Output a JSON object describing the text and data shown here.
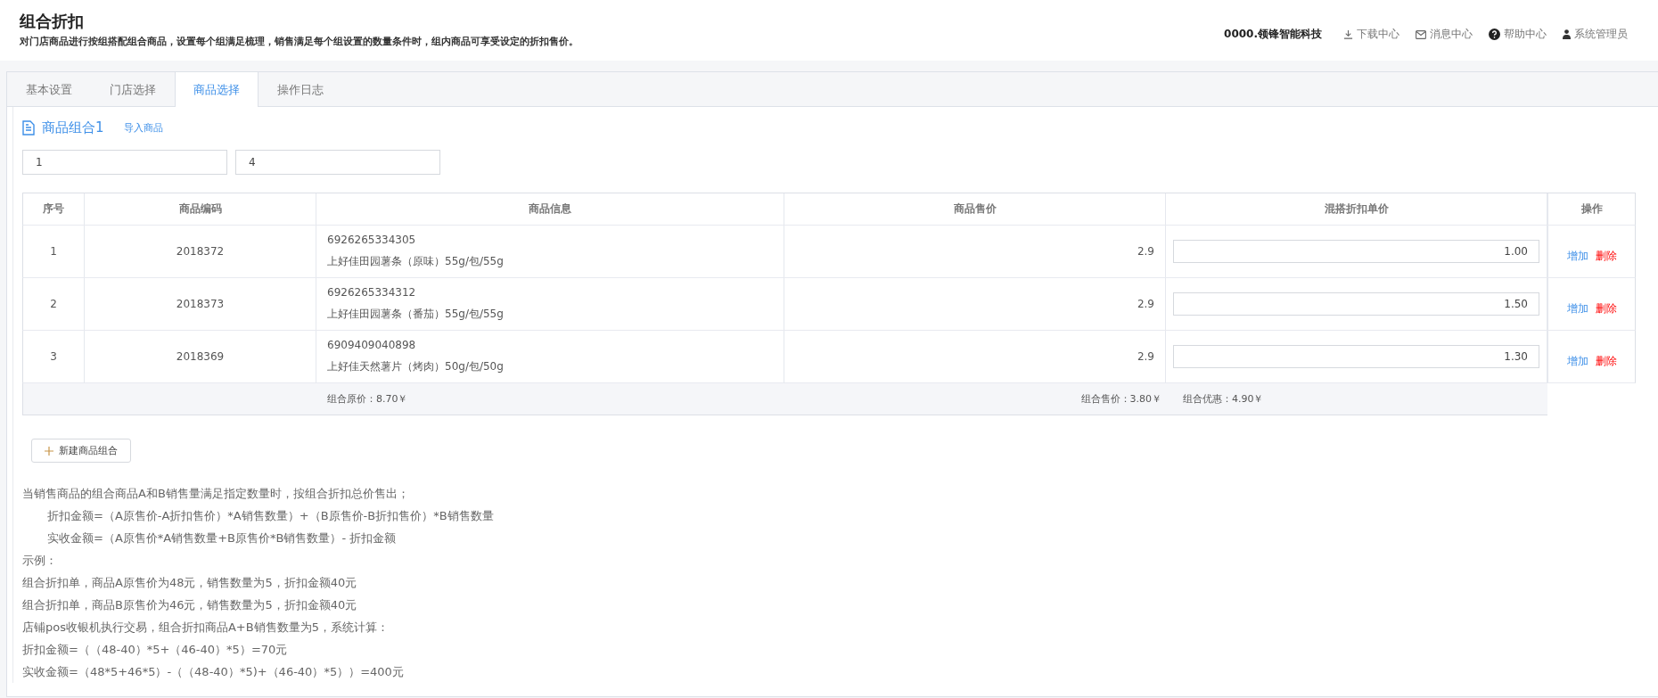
{
  "header": {
    "title": "组合折扣",
    "subtitle": "对门店商品进行按组搭配组合商品，设置每个组满足梳理，销售满足每个组设置的数量条件时，组内商品可享受设定的折扣售价。",
    "company": "0000.领锋智能科技",
    "links": [
      {
        "kind": "download",
        "label": "下载中心"
      },
      {
        "kind": "message",
        "label": "消息中心"
      },
      {
        "kind": "help",
        "label": "帮助中心"
      },
      {
        "kind": "user",
        "label": "系统管理员"
      }
    ]
  },
  "tabs": [
    {
      "label": "基本设置",
      "selected": false
    },
    {
      "label": "门店选择",
      "selected": false
    },
    {
      "label": "商品选择",
      "selected": true
    },
    {
      "label": "操作日志",
      "selected": false
    }
  ],
  "group": {
    "title": "商品组合1",
    "import_link": "导入商品",
    "fields": [
      "1",
      "4"
    ],
    "table": {
      "columns": [
        "序号",
        "商品编码",
        "商品信息",
        "商品售价",
        "混搭折扣单价",
        "操作"
      ],
      "rows": [
        {
          "index": "1",
          "code": "2018372",
          "barcode": "6926265334305",
          "name": "上好佳田园薯条（原味）55g/包/55g",
          "price": "2.9",
          "discount_price": "1.00",
          "actions": [
            "增加",
            "删除"
          ]
        },
        {
          "index": "2",
          "code": "2018373",
          "barcode": "6926265334312",
          "name": "上好佳田园薯条（番茄）55g/包/55g",
          "price": "2.9",
          "discount_price": "1.50",
          "actions": [
            "增加",
            "删除"
          ]
        },
        {
          "index": "3",
          "code": "2018369",
          "barcode": "6909409040898",
          "name": "上好佳天然薯片（烤肉）50g/包/50g",
          "price": "2.9",
          "discount_price": "1.30",
          "actions": [
            "增加",
            "删除"
          ]
        }
      ],
      "footer": {
        "original_total": "组合原价：8.70￥",
        "sale_total": "组合售价：3.80￥",
        "saving": "组合优惠：4.90￥"
      }
    }
  },
  "new_group_button": "新建商品组合",
  "notes": [
    {
      "text": "当销售商品的组合商品A和B销售量满足指定数量时，按组合折扣总价售出；",
      "indent": false
    },
    {
      "text": "折扣金额=（A原售价-A折扣售价）*A销售数量）+（B原售价-B折扣售价）*B销售数量",
      "indent": true
    },
    {
      "text": "实收金额=（A原售价*A销售数量+B原售价*B销售数量）- 折扣金额",
      "indent": true
    },
    {
      "text": "示例：",
      "indent": false
    },
    {
      "text": "组合折扣单，商品A原售价为48元，销售数量为5，折扣金额40元",
      "indent": false
    },
    {
      "text": "组合折扣单，商品B原售价为46元，销售数量为5，折扣金额40元",
      "indent": false
    },
    {
      "text": "店铺pos收银机执行交易，组合折扣商品A+B销售数量为5，系统计算：",
      "indent": false
    },
    {
      "text": "折扣金额=（（48-40）*5+（46-40）*5）=70元",
      "indent": false
    },
    {
      "text": "实收金额=（48*5+46*5）-（（48-40）*5)+（46-40）*5））=400元",
      "indent": false
    }
  ]
}
